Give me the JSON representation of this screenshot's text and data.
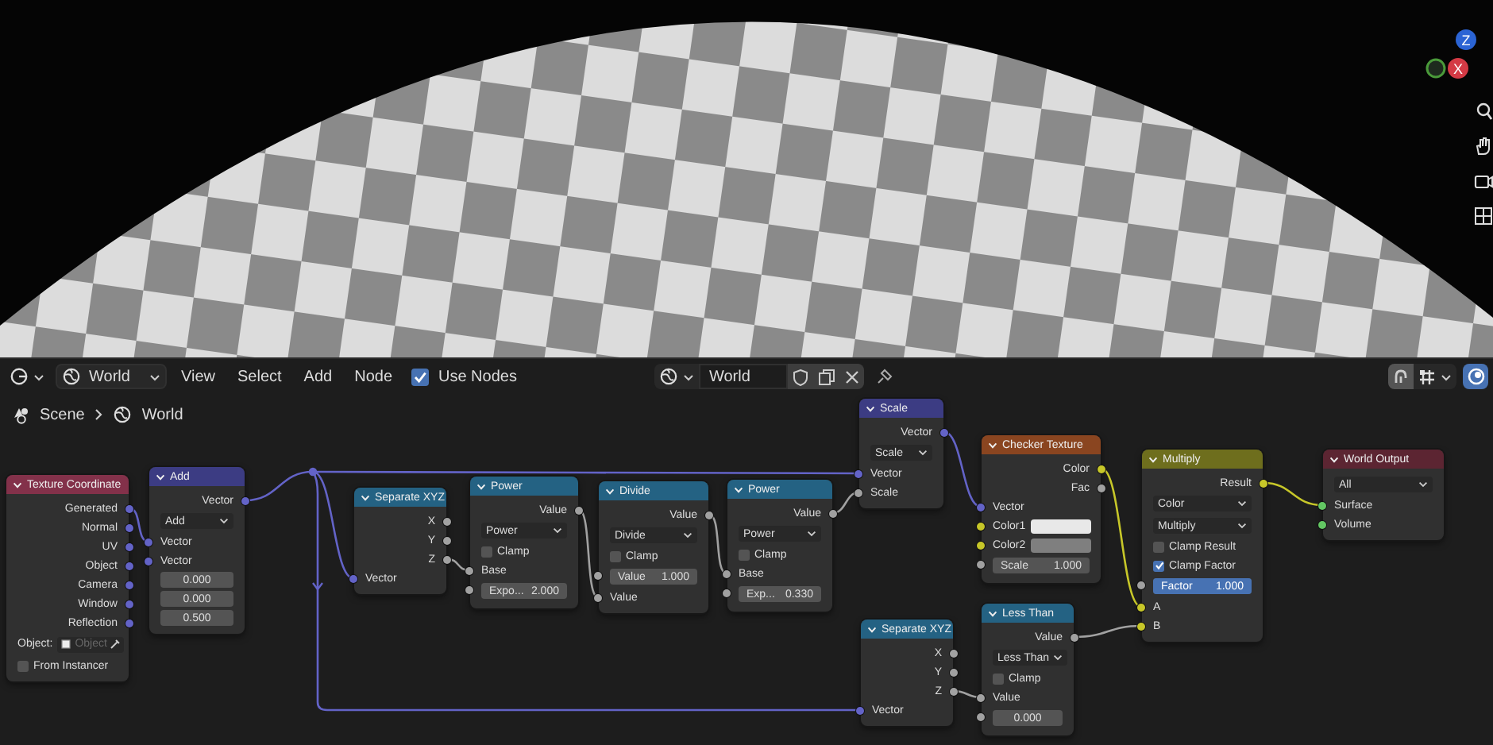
{
  "viewport": {
    "axes": [
      {
        "label": "Z",
        "color": "#2b64d4"
      },
      {
        "label": "X",
        "color": "#d43a45"
      }
    ]
  },
  "header": {
    "world_dropdown": "World",
    "menus": [
      "View",
      "Select",
      "Add",
      "Node"
    ],
    "use_nodes": {
      "label": "Use Nodes",
      "checked": true
    },
    "datablock": "World"
  },
  "breadcrumbs": [
    "Scene",
    "World"
  ],
  "nodes": [
    {
      "title": "Texture Coordinate",
      "color": "#83314a",
      "rows": [
        {
          "kind": "output",
          "label": "Generated",
          "socket": {
            "color": "#6363c7"
          }
        },
        {
          "kind": "output",
          "label": "Normal",
          "socket": {
            "color": "#6363c7"
          }
        },
        {
          "kind": "output",
          "label": "UV",
          "socket": {
            "color": "#6363c7"
          }
        },
        {
          "kind": "output",
          "label": "Object",
          "socket": {
            "color": "#6363c7"
          }
        },
        {
          "kind": "output",
          "label": "Camera",
          "socket": {
            "color": "#6363c7"
          }
        },
        {
          "kind": "output",
          "label": "Window",
          "socket": {
            "color": "#6363c7"
          }
        },
        {
          "kind": "output",
          "label": "Reflection",
          "socket": {
            "color": "#6363c7"
          }
        },
        {
          "kind": "object",
          "label": "Object:",
          "placeholder": "Object"
        },
        {
          "kind": "checkbox",
          "label": "From Instancer",
          "checked": false
        }
      ]
    },
    {
      "title": "Add",
      "color": "#3c3c83",
      "rows": [
        {
          "kind": "output",
          "label": "Vector",
          "socket": {
            "color": "#6363c7"
          }
        },
        {
          "kind": "dropdown",
          "value": "Add"
        },
        {
          "kind": "input",
          "label": "Vector",
          "socket": {
            "color": "#6363c7"
          }
        },
        {
          "kind": "input",
          "label": "Vector",
          "socket": {
            "color": "#6363c7"
          }
        },
        {
          "kind": "field",
          "value": "0.000"
        },
        {
          "kind": "field",
          "value": "0.000"
        },
        {
          "kind": "field",
          "value": "0.500"
        }
      ]
    },
    {
      "title": "Separate XYZ",
      "color": "#246283",
      "rows": [
        {
          "kind": "output",
          "label": "X",
          "socket": {
            "color": "#a1a1a1"
          }
        },
        {
          "kind": "output",
          "label": "Y",
          "socket": {
            "color": "#a1a1a1"
          }
        },
        {
          "kind": "output",
          "label": "Z",
          "socket": {
            "color": "#a1a1a1"
          }
        },
        {
          "kind": "input",
          "label": "Vector",
          "socket": {
            "color": "#6363c7"
          }
        }
      ]
    },
    {
      "title": "Power",
      "color": "#246283",
      "rows": [
        {
          "kind": "output",
          "label": "Value",
          "socket": {
            "color": "#a1a1a1"
          }
        },
        {
          "kind": "dropdown",
          "value": "Power"
        },
        {
          "kind": "checkbox",
          "label": "Clamp",
          "checked": false
        },
        {
          "kind": "input",
          "label": "Base",
          "socket": {
            "color": "#a1a1a1"
          }
        },
        {
          "kind": "field",
          "label": "Expo...",
          "value": "2.000",
          "socket": {
            "color": "#a1a1a1"
          }
        }
      ]
    },
    {
      "title": "Divide",
      "color": "#246283",
      "rows": [
        {
          "kind": "output",
          "label": "Value",
          "socket": {
            "color": "#a1a1a1"
          }
        },
        {
          "kind": "dropdown",
          "value": "Divide"
        },
        {
          "kind": "checkbox",
          "label": "Clamp",
          "checked": false
        },
        {
          "kind": "field",
          "label": "Value",
          "value": "1.000",
          "socket": {
            "color": "#a1a1a1"
          }
        },
        {
          "kind": "input",
          "label": "Value",
          "socket": {
            "color": "#a1a1a1"
          }
        }
      ]
    },
    {
      "title": "Power",
      "color": "#246283",
      "rows": [
        {
          "kind": "output",
          "label": "Value",
          "socket": {
            "color": "#a1a1a1"
          }
        },
        {
          "kind": "dropdown",
          "value": "Power"
        },
        {
          "kind": "checkbox",
          "label": "Clamp",
          "checked": false
        },
        {
          "kind": "input",
          "label": "Base",
          "socket": {
            "color": "#a1a1a1"
          }
        },
        {
          "kind": "field",
          "label": "Exp...",
          "value": "0.330",
          "socket": {
            "color": "#a1a1a1"
          }
        }
      ]
    },
    {
      "title": "Scale",
      "color": "#3c3c83",
      "rows": [
        {
          "kind": "output",
          "label": "Vector",
          "socket": {
            "color": "#6363c7"
          }
        },
        {
          "kind": "dropdown",
          "value": "Scale"
        },
        {
          "kind": "input",
          "label": "Vector",
          "socket": {
            "color": "#6363c7"
          }
        },
        {
          "kind": "input",
          "label": "Scale",
          "socket": {
            "color": "#a1a1a1"
          }
        }
      ]
    },
    {
      "title": "Checker Texture",
      "color": "#8a4520",
      "rows": [
        {
          "kind": "output",
          "label": "Color",
          "socket": {
            "color": "#c7c729"
          }
        },
        {
          "kind": "output",
          "label": "Fac",
          "socket": {
            "color": "#a1a1a1"
          }
        },
        {
          "kind": "input",
          "label": "Vector",
          "socket": {
            "color": "#6363c7"
          }
        },
        {
          "kind": "color",
          "label": "Color1",
          "color": "#e8e8e8",
          "socket": {
            "color": "#c7c729"
          }
        },
        {
          "kind": "color",
          "label": "Color2",
          "color": "#7f7f7f",
          "socket": {
            "color": "#c7c729"
          }
        },
        {
          "kind": "field",
          "label": "Scale",
          "value": "1.000",
          "socket": {
            "color": "#a1a1a1"
          }
        }
      ]
    },
    {
      "title": "Multiply",
      "color": "#6e6e1d",
      "rows": [
        {
          "kind": "output",
          "label": "Result",
          "socket": {
            "color": "#c7c729"
          }
        },
        {
          "kind": "dropdown",
          "value": "Color"
        },
        {
          "kind": "dropdown",
          "value": "Multiply"
        },
        {
          "kind": "checkbox",
          "label": "Clamp Result",
          "checked": false
        },
        {
          "kind": "checkbox",
          "label": "Clamp Factor",
          "checked": true
        },
        {
          "kind": "field",
          "label": "Factor",
          "value": "1.000",
          "socket": {
            "color": "#a1a1a1"
          },
          "level": 1
        },
        {
          "kind": "input",
          "label": "A",
          "socket": {
            "color": "#c7c729"
          }
        },
        {
          "kind": "input",
          "label": "B",
          "socket": {
            "color": "#c7c729"
          }
        }
      ]
    },
    {
      "title": "World Output",
      "color": "#5c2532",
      "rows": [
        {
          "kind": "dropdown",
          "value": "All"
        },
        {
          "kind": "input",
          "label": "Surface",
          "socket": {
            "color": "#63c763"
          }
        },
        {
          "kind": "input",
          "label": "Volume",
          "socket": {
            "color": "#63c763"
          }
        }
      ]
    },
    {
      "title": "Separate XYZ",
      "color": "#246283",
      "rows": [
        {
          "kind": "output",
          "label": "X",
          "socket": {
            "color": "#a1a1a1"
          }
        },
        {
          "kind": "output",
          "label": "Y",
          "socket": {
            "color": "#a1a1a1"
          }
        },
        {
          "kind": "output",
          "label": "Z",
          "socket": {
            "color": "#a1a1a1"
          }
        },
        {
          "kind": "input",
          "label": "Vector",
          "socket": {
            "color": "#6363c7"
          }
        }
      ]
    },
    {
      "title": "Less Than",
      "color": "#246283",
      "rows": [
        {
          "kind": "output",
          "label": "Value",
          "socket": {
            "color": "#a1a1a1"
          }
        },
        {
          "kind": "dropdown",
          "value": "Less Than"
        },
        {
          "kind": "checkbox",
          "label": "Clamp",
          "checked": false
        },
        {
          "kind": "input",
          "label": "Value",
          "socket": {
            "color": "#a1a1a1"
          }
        },
        {
          "kind": "field",
          "value": "0.000",
          "socket": {
            "color": "#a1a1a1"
          }
        }
      ]
    }
  ]
}
